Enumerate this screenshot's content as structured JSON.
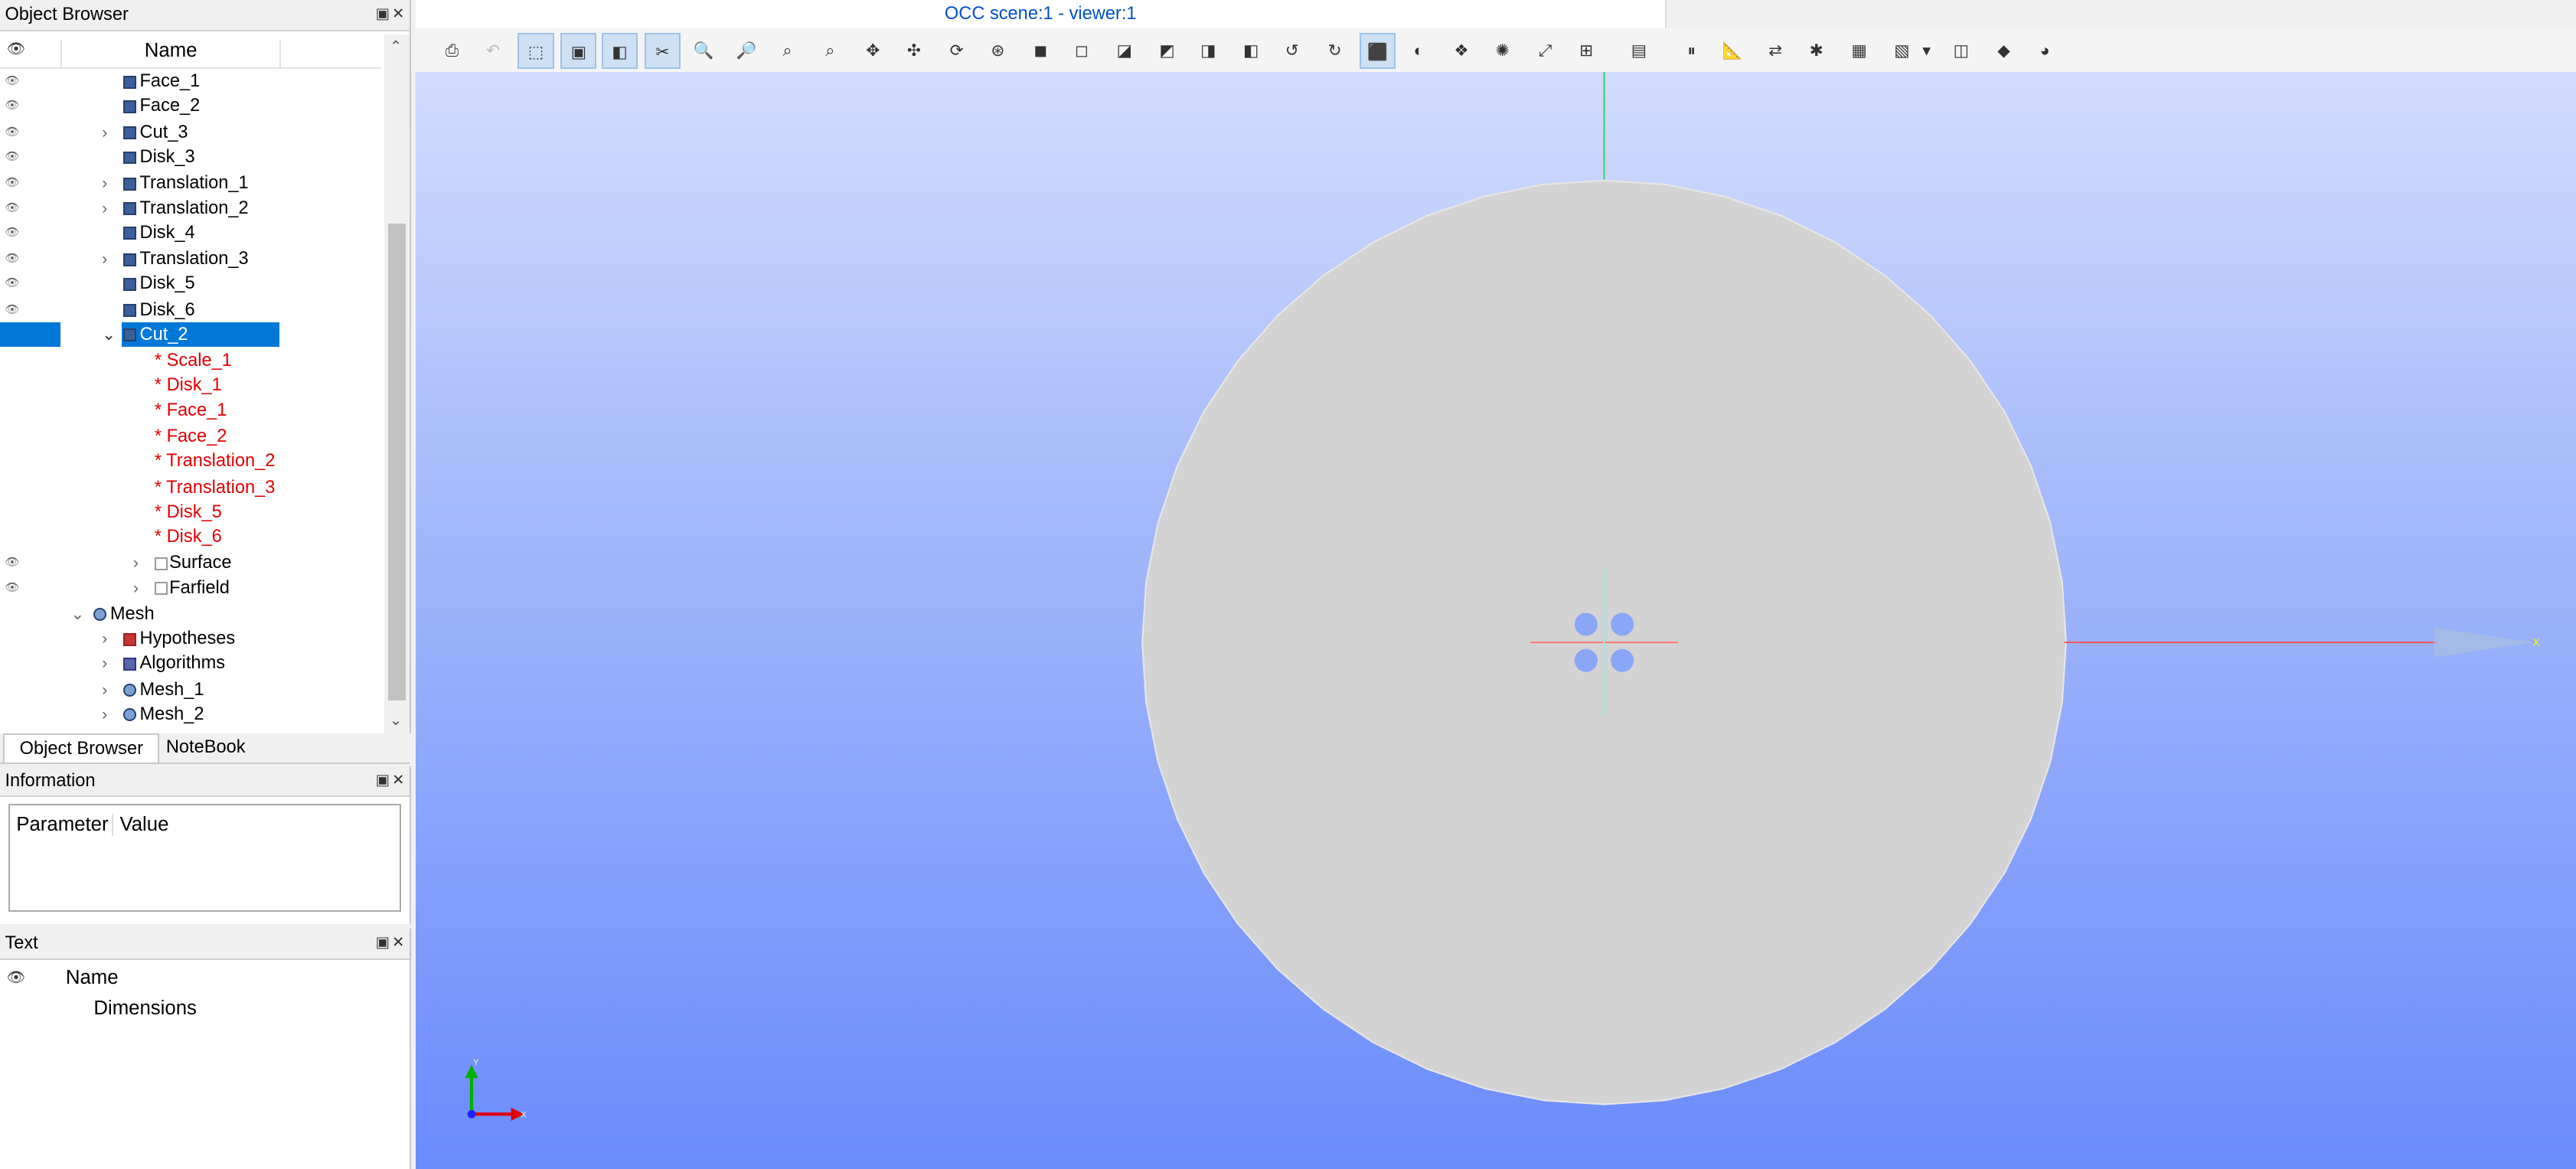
{
  "object_browser": {
    "title": "Object Browser",
    "column_name": "Name",
    "rows": [
      {
        "label": "Face_1"
      },
      {
        "label": "Face_2"
      },
      {
        "label": "Cut_3"
      },
      {
        "label": "Disk_3"
      },
      {
        "label": "Translation_1"
      },
      {
        "label": "Translation_2"
      },
      {
        "label": "Disk_4"
      },
      {
        "label": "Translation_3"
      },
      {
        "label": "Disk_5"
      },
      {
        "label": "Disk_6"
      },
      {
        "label": "Cut_2"
      },
      {
        "label": "* Scale_1"
      },
      {
        "label": "* Disk_1"
      },
      {
        "label": "* Face_1"
      },
      {
        "label": "* Face_2"
      },
      {
        "label": "* Translation_2"
      },
      {
        "label": "* Translation_3"
      },
      {
        "label": "* Disk_5"
      },
      {
        "label": "* Disk_6"
      },
      {
        "label": "Surface"
      },
      {
        "label": "Farfield"
      },
      {
        "label": "Mesh"
      },
      {
        "label": "Hypotheses"
      },
      {
        "label": "Algorithms"
      },
      {
        "label": "Mesh_1"
      },
      {
        "label": "Mesh_2"
      }
    ],
    "tabs": [
      "Object Browser",
      "NoteBook"
    ]
  },
  "information": {
    "title": "Information",
    "col_parameter": "Parameter",
    "col_value": "Value"
  },
  "text_panel": {
    "title": "Text",
    "col_name": "Name",
    "item": "Dimensions"
  },
  "viewer": {
    "title": "OCC scene:1 - viewer:1",
    "axis_x": "X",
    "axis_y": "Y",
    "colors": {
      "background_top": "#d2dcfd",
      "background_bottom": "#6a8bfc",
      "shape_fill": "#d3d3d3",
      "selection": "#0078d7",
      "red_text": "#e00000"
    }
  }
}
